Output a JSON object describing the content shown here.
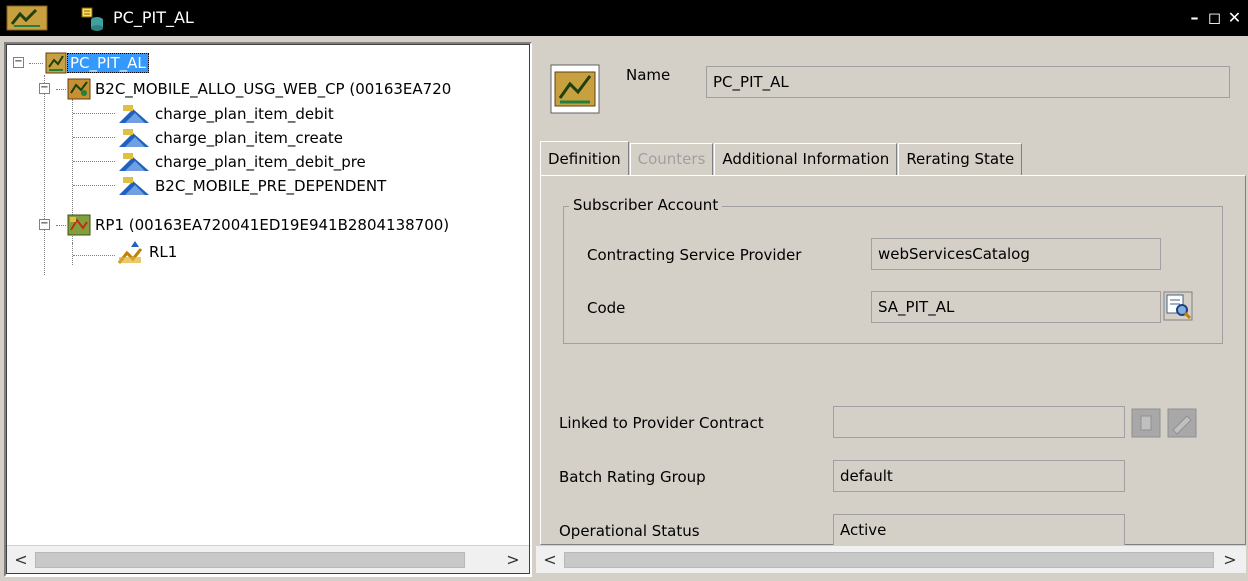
{
  "window": {
    "title": "PC_PIT_AL",
    "controls": [
      "–",
      "◻",
      "✕"
    ]
  },
  "tree": {
    "root": {
      "label": "PC_PIT_AL"
    },
    "items": [
      {
        "label": "B2C_MOBILE_ALLO_USG_WEB_CP (00163EA720",
        "level": 1
      },
      {
        "label": "charge_plan_item_debit",
        "level": 2
      },
      {
        "label": "charge_plan_item_create",
        "level": 2
      },
      {
        "label": "charge_plan_item_debit_pre",
        "level": 2
      },
      {
        "label": "B2C_MOBILE_PRE_DEPENDENT",
        "level": 2
      },
      {
        "label": "RP1 (00163EA720041ED19E941B2804138700)",
        "level": 1
      },
      {
        "label": "RL1",
        "level": 2
      }
    ]
  },
  "header": {
    "name_label": "Name",
    "name_value": "PC_PIT_AL"
  },
  "tabs": [
    {
      "label": "Definition",
      "state": "active"
    },
    {
      "label": "Counters",
      "state": "disabled"
    },
    {
      "label": "Additional Information",
      "state": "normal"
    },
    {
      "label": "Rerating State",
      "state": "normal"
    }
  ],
  "definition": {
    "group_title": "Subscriber Account",
    "contracting_label": "Contracting Service Provider",
    "contracting_value": "webServicesCatalog",
    "code_label": "Code",
    "code_value": "SA_PIT_AL",
    "linked_label": "Linked to Provider Contract",
    "linked_value": "",
    "batch_label": "Batch Rating Group",
    "batch_value": "default",
    "status_label": "Operational Status",
    "status_value": "Active"
  },
  "scrollbars": {
    "left_arrow": "<",
    "right_arrow": ">"
  }
}
